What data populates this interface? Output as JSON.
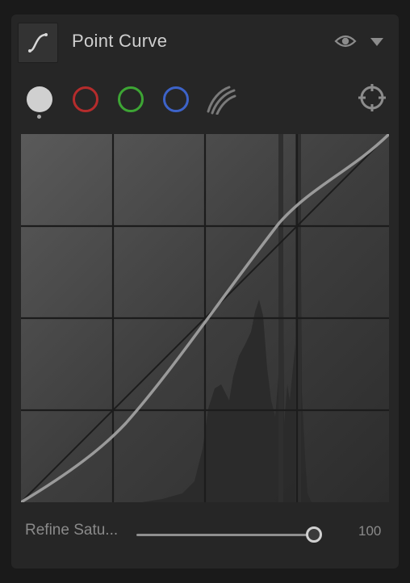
{
  "panel": {
    "title": "Point Curve",
    "icons": [
      "curve-icon",
      "eye-icon",
      "chevron-down-icon",
      "target-icon"
    ]
  },
  "channels": [
    {
      "name": "luminance",
      "color": "#d0d0d0",
      "selected": true
    },
    {
      "name": "red",
      "color": "#b52c2c"
    },
    {
      "name": "green",
      "color": "#3da534"
    },
    {
      "name": "blue",
      "color": "#3d63c9"
    },
    {
      "name": "parametric",
      "icon": "parametric-curve-icon"
    }
  ],
  "slider": {
    "label": "Refine Satu...",
    "value": "100",
    "fraction": 1.0
  }
}
